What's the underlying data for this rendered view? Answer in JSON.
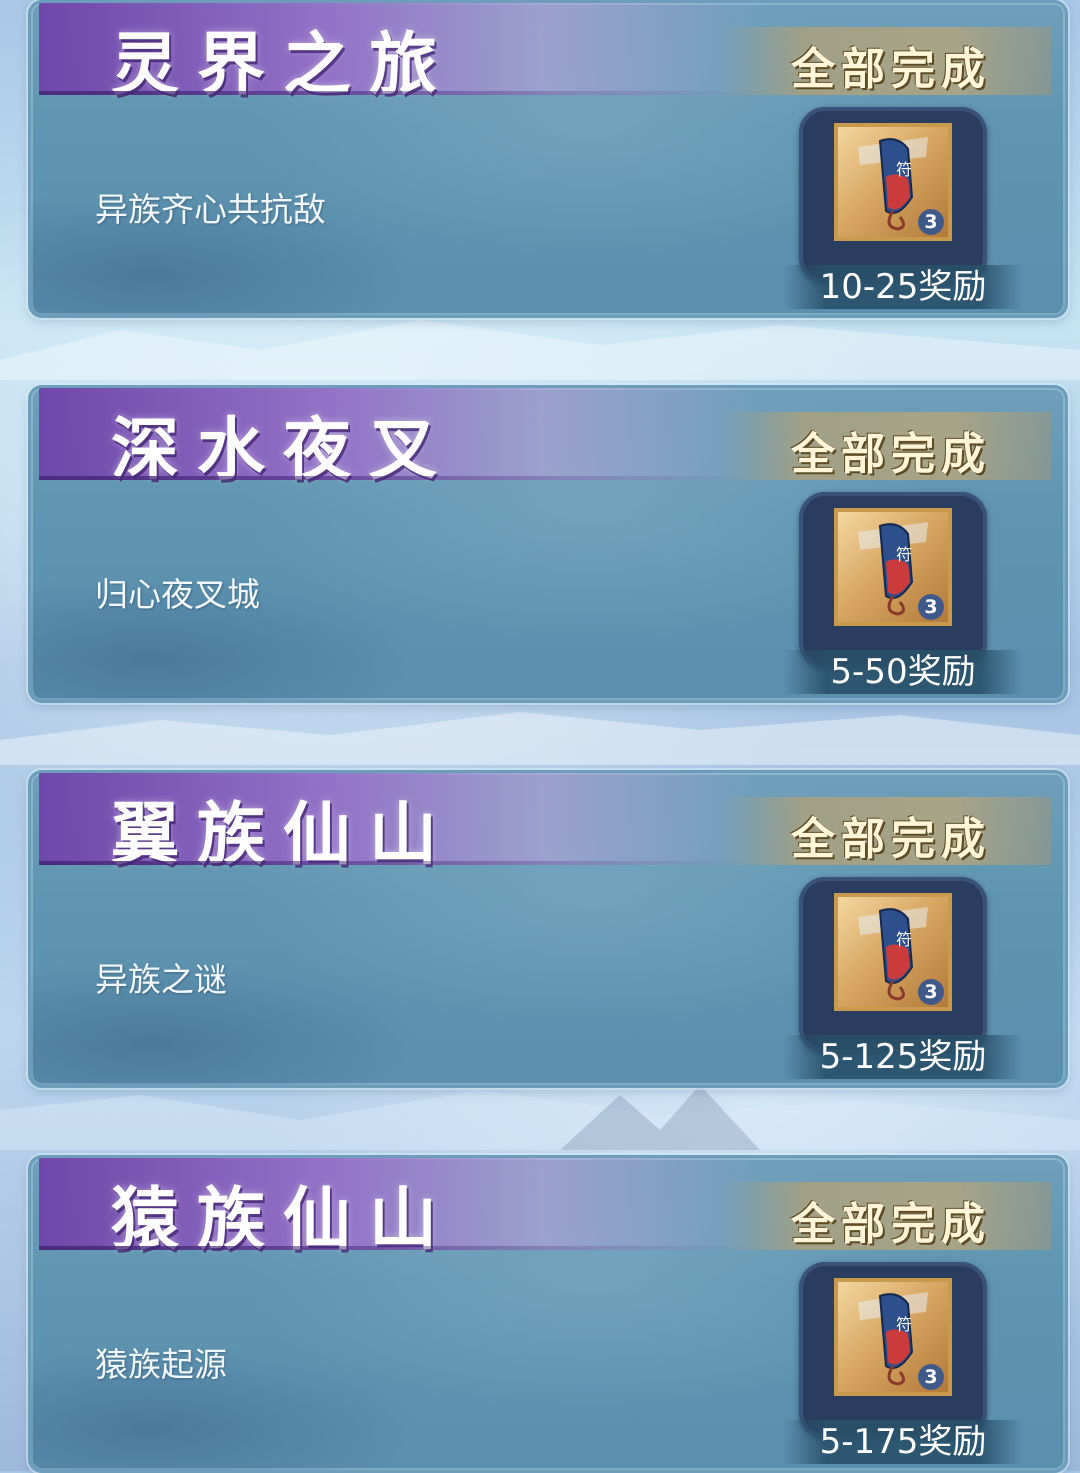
{
  "quests": [
    {
      "title": "灵界之旅",
      "status": "全部完成",
      "description": "异族齐心共抗敌",
      "reward_count": "3",
      "reward_level": "10-25奖励"
    },
    {
      "title": "深水夜叉",
      "status": "全部完成",
      "description": "归心夜叉城",
      "reward_count": "3",
      "reward_level": "5-50奖励"
    },
    {
      "title": "翼族仙山",
      "status": "全部完成",
      "description": "异族之谜",
      "reward_count": "3",
      "reward_level": "5-125奖励"
    },
    {
      "title": "猿族仙山",
      "status": "全部完成",
      "description": "猿族起源",
      "reward_count": "3",
      "reward_level": "5-175奖励"
    }
  ],
  "colors": {
    "title_banner": "#8a5cc0",
    "card_body": "#5f95b0",
    "reward_frame": "#2a3d5e",
    "reward_border": "#c79a4d"
  },
  "icons": {
    "reward": "scroll-icon"
  }
}
